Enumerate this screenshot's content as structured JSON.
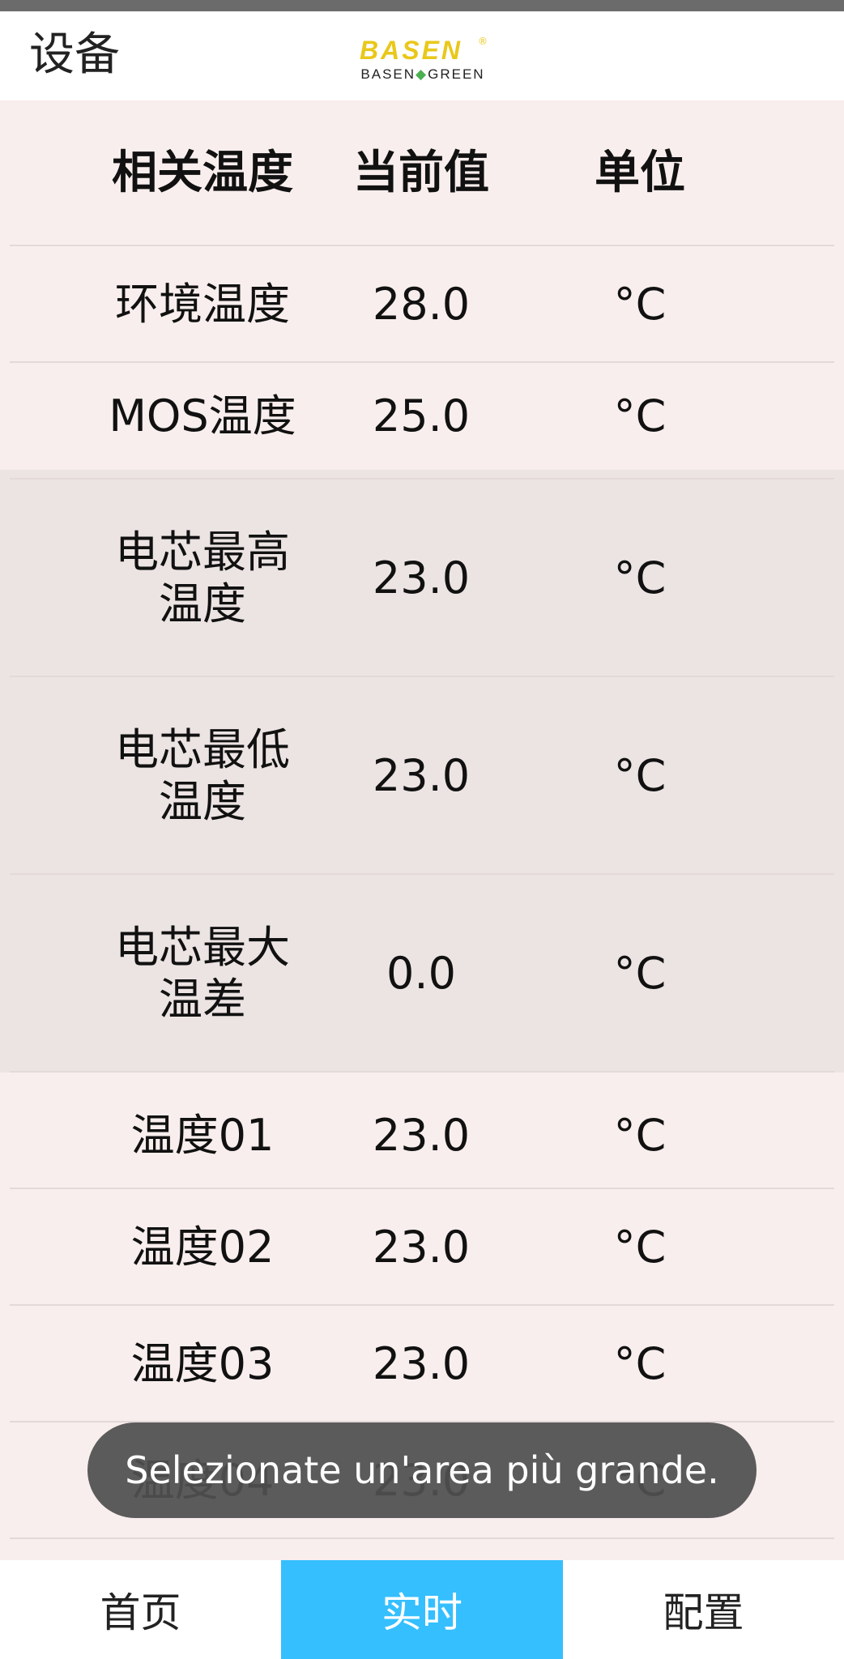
{
  "header": {
    "title": "设备",
    "logo": {
      "top": "BASEN",
      "bottom_left": "BASEN",
      "bottom_right": "GREEN",
      "reg": "®",
      "color": "#e9c81a"
    }
  },
  "table": {
    "columns": [
      "相关温度",
      "当前值",
      "单位"
    ],
    "rows": [
      {
        "name": "环境温度",
        "value": "28.0",
        "unit": "°C"
      },
      {
        "name": "MOS温度",
        "value": "25.0",
        "unit": "°C"
      },
      {
        "name": "电芯最高温度",
        "value": "23.0",
        "unit": "°C"
      },
      {
        "name": "电芯最低温度",
        "value": "23.0",
        "unit": "°C"
      },
      {
        "name": "电芯最大温差",
        "value": "0.0",
        "unit": "°C"
      },
      {
        "name": "温度01",
        "value": "23.0",
        "unit": "°C"
      },
      {
        "name": "温度02",
        "value": "23.0",
        "unit": "°C"
      },
      {
        "name": "温度03",
        "value": "23.0",
        "unit": "°C"
      },
      {
        "name": "温度04",
        "value": "23.0",
        "unit": "°C"
      }
    ]
  },
  "toast": {
    "message": "Selezionate un'area più grande."
  },
  "bottom_nav": {
    "tabs": [
      "首页",
      "实时",
      "配置"
    ],
    "active_index": 1,
    "active_color": "#35bfff"
  }
}
